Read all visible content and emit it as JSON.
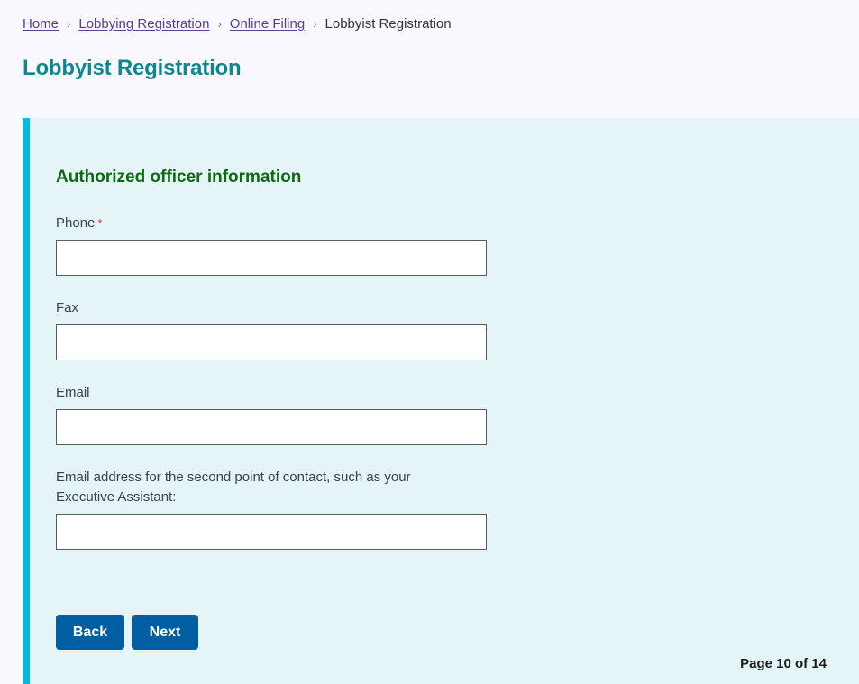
{
  "breadcrumb": {
    "items": [
      {
        "label": "Home",
        "link": true
      },
      {
        "label": "Lobbying Registration",
        "link": true
      },
      {
        "label": "Online Filing",
        "link": true
      },
      {
        "label": "Lobbyist Registration",
        "link": false
      }
    ],
    "separator": "›"
  },
  "page": {
    "title": "Lobbyist Registration"
  },
  "form": {
    "section_title": "Authorized officer information",
    "required_marker": "*",
    "fields": [
      {
        "label": "Phone",
        "required": true,
        "value": "",
        "placeholder": ""
      },
      {
        "label": "Fax",
        "required": false,
        "value": "",
        "placeholder": ""
      },
      {
        "label": "Email",
        "required": false,
        "value": "",
        "placeholder": ""
      },
      {
        "label": "Email address for the second point of contact, such as your Executive Assistant:",
        "required": false,
        "value": "",
        "placeholder": ""
      }
    ],
    "buttons": {
      "back": "Back",
      "next": "Next"
    },
    "pagination": "Page 10 of 14"
  },
  "colors": {
    "title": "#10878e",
    "section_title": "#0c6a10",
    "panel_bg": "#e5f4f6",
    "panel_accent": "#0ab9dc",
    "button": "#005ea2",
    "link": "#5a3d8c",
    "required": "#d83933"
  }
}
